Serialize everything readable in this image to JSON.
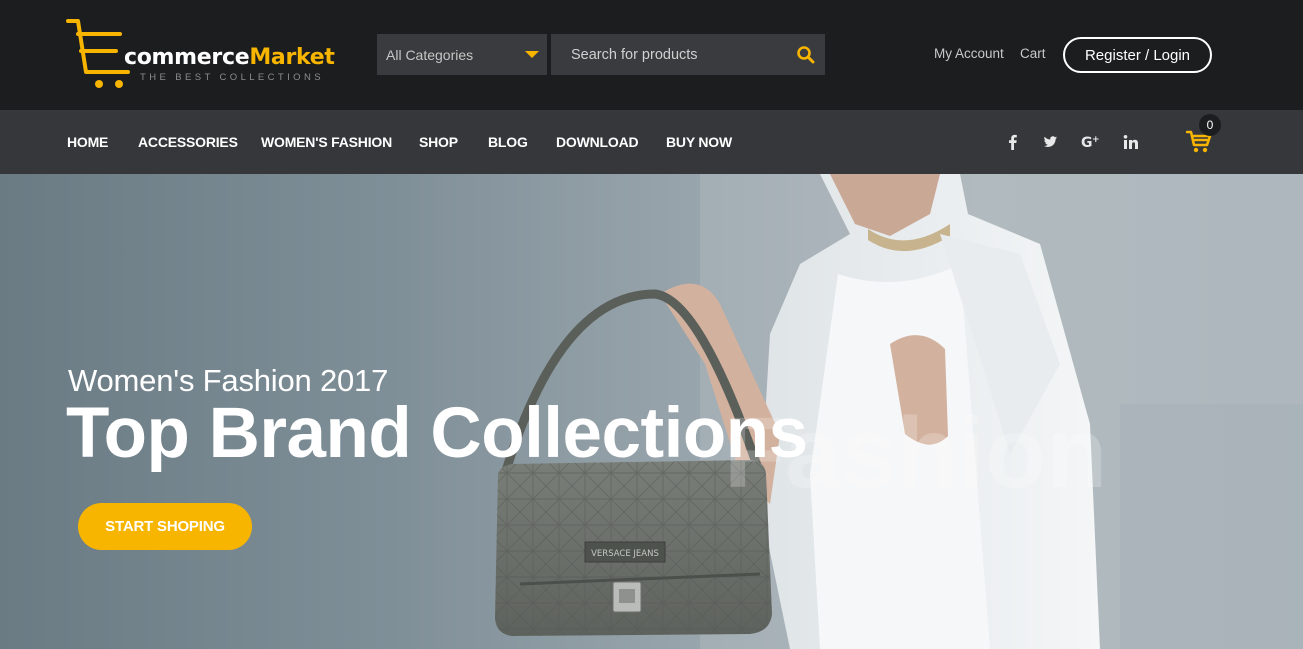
{
  "header": {
    "logo": {
      "word_main": "commerce",
      "word_accent": "Market",
      "tagline": "THE BEST COLLECTIONS"
    },
    "category_select": {
      "selected": "All Categories"
    },
    "search": {
      "placeholder": "Search for products"
    },
    "links": {
      "my_account": "My Account",
      "cart": "Cart"
    },
    "register_button": "Register / Login"
  },
  "nav": {
    "items": [
      {
        "label": "HOME"
      },
      {
        "label": "ACCESSORIES"
      },
      {
        "label": "WOMEN'S FASHION"
      },
      {
        "label": "SHOP"
      },
      {
        "label": "BLOG"
      },
      {
        "label": "DOWNLOAD"
      },
      {
        "label": "BUY NOW"
      }
    ],
    "social_icons": [
      "facebook-icon",
      "twitter-icon",
      "google-plus-icon",
      "linkedin-icon"
    ],
    "cart_count": "0"
  },
  "hero": {
    "subtitle": "Women's Fashion 2017",
    "title": "Top Brand Collections",
    "background_word": "Fashion",
    "cta_label": "START SHOPING",
    "bag_brand": "VERSACE JEANS"
  },
  "colors": {
    "accent": "#f7b500",
    "header_bg": "#1c1d1f",
    "nav_bg": "#35373a",
    "input_bg": "#3a3b3e"
  }
}
